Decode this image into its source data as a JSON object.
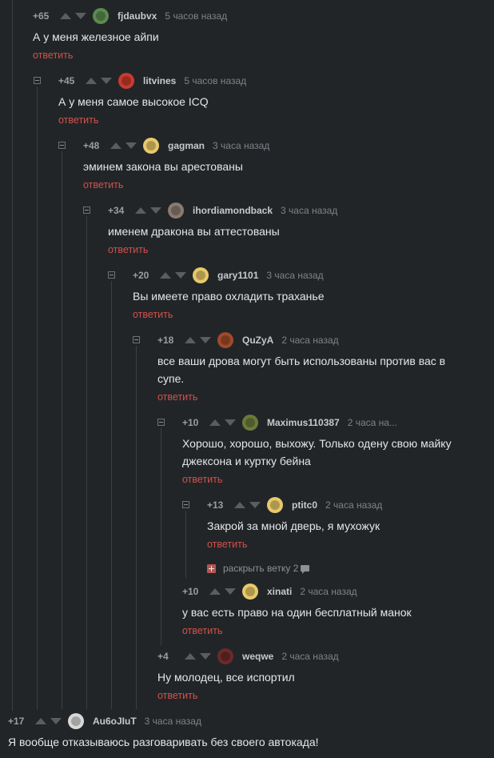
{
  "reply_label": "ответить",
  "comments": [
    {
      "id": "c1",
      "rating": "+65",
      "user": "fjdaubvx",
      "time": "5 часов назад",
      "text": "А у меня железное айпи",
      "avatar_color": "#5b8a4e"
    },
    {
      "id": "c2",
      "rating": "+45",
      "user": "litvines",
      "time": "5 часов назад",
      "text": "А у меня самое высокое ICQ",
      "avatar_color": "#c93a2f"
    },
    {
      "id": "c3",
      "rating": "+48",
      "user": "gagman",
      "time": "3 часа назад",
      "text": "эминем закона вы арестованы",
      "avatar_color": "#e8c96a"
    },
    {
      "id": "c4",
      "rating": "+34",
      "user": "ihordiamondback",
      "time": "3 часа назад",
      "text": "именем дракона вы аттестованы",
      "avatar_color": "#8a7a70"
    },
    {
      "id": "c5",
      "rating": "+20",
      "user": "gary1101",
      "time": "3 часа назад",
      "text": "Вы имеете право охладить траханье",
      "avatar_color": "#e8c96a"
    },
    {
      "id": "c6",
      "rating": "+18",
      "user": "QuZyA",
      "time": "2 часа назад",
      "text": "все ваши дрова могут быть использованы против вас в супе.",
      "avatar_color": "#a04a2a"
    },
    {
      "id": "c7",
      "rating": "+10",
      "user": "Maximus110387",
      "time": "2 часа на...",
      "text": "Хорошо, хорошо, выхожу. Только одену свою майку джексона и куртку бейна",
      "avatar_color": "#6b7a3a"
    },
    {
      "id": "c8",
      "rating": "+13",
      "user": "ptitc0",
      "time": "2 часа назад",
      "text": "Закрой за мной дверь, я мухожук",
      "avatar_color": "#e8c96a"
    },
    {
      "id": "c9",
      "rating": "+10",
      "user": "xinati",
      "time": "2 часа назад",
      "text": "у вас есть право на один бесплатный манок",
      "avatar_color": "#e8c96a"
    },
    {
      "id": "c10",
      "rating": "+4",
      "user": "weqwe",
      "time": "2 часа назад",
      "text": "Ну молодец, все испортил",
      "avatar_color": "#6a2a2a"
    },
    {
      "id": "c11",
      "rating": "+17",
      "user": "Au6oJIuT",
      "time": "3 часа назад",
      "text": "Я вообще отказываюсь разговаривать без своего автокада!",
      "avatar_color": "#d8d8d8"
    }
  ],
  "expand_branch": {
    "label": "раскрыть ветку",
    "count": "2"
  }
}
